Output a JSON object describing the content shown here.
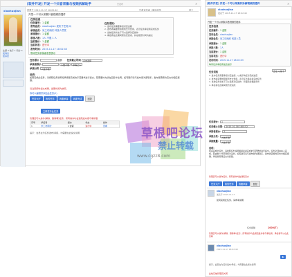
{
  "left": {
    "post_title": "[软件开发] 开发一个抖音采集与视频拆解助手",
    "post_badge": "已发布",
    "username": "xiaohuojian",
    "post_meta": "发表于 2015-11-17 18:02:40",
    "post_meta_right": "只看该作者 | 倒序浏览",
    "floor": "楼主",
    "intro": "开发一个可以采集抖音视频的插件",
    "info_header": "任务信息",
    "fields": [
      {
        "k": "任务编号",
        "v": "1 金额"
      },
      {
        "k": "发布会员",
        "v": "xiaohuojian 发布了任务(0)"
      },
      {
        "k": "承接会员",
        "v": "米工坊雨欣 科技人员发"
      },
      {
        "k": "承接报价",
        "v": "1 金额"
      },
      {
        "k": "承接人数",
        "v": "1人 不限 1 人"
      },
      {
        "k": "当前报价",
        "v": "1 金额"
      },
      {
        "k": "当前状态",
        "v": "进行中"
      },
      {
        "k": "发布时间",
        "v": "2015-11-17 18:02:40"
      }
    ],
    "status_line": "等待任务承接者发表提示",
    "task_notes_title": "任务须知：",
    "task_notes": [
      "1. 发布任务需要承担对应金额",
      "2. 发布者需要按照规则支付费用，表示任务承接者完成任务",
      "3. 当前任务状态下可以选择对应操作",
      "4. 承接者在此期间按约定完成，并在规定时间内提交"
    ],
    "bid_label": "任务报价",
    "bid_unit": "金额",
    "deadline_label": "任务截止时间",
    "deadline_value": "点击选择",
    "handle_label": "承接者报价",
    "handle_sel_1": "人数不限",
    "handle_sel_2": "中等之人",
    "category_label": "承接分类",
    "category_sel": "人数不限",
    "desc_label": "说明：",
    "desc": "如需完成此任务，请按照任务说明和承接者完成的示范要求进行提交，若需要补充请在回复中注明。如有疑问请与发布者沟通联系，发布者需按约定支付相应报酬。",
    "desc_highlight": "请注意按时提交成果，逾期将视为放弃。",
    "edit_label": "你可以编辑并添加此任务(0)",
    "action_buttons": [
      "任务大厅",
      "我的任务",
      "我要承接",
      "我要完成",
      "回复"
    ],
    "publish_button": "立即发布此任务",
    "warn_text": "管理员可以操作(解除、删除等)任务，所有操作均会通知发布者与承接者",
    "table_headers": [
      "序号",
      "承接者",
      "报价",
      "状态",
      "操作"
    ],
    "table_row": [
      "1",
      "米工坊雨欣",
      "1 金额",
      "进行中",
      "查看"
    ],
    "footer_note": "提示：会员在为任务发布/承接，均需要在此提交说明",
    "sidebar_profile_lines": [
      "主题 0  帖子 1  积分 3",
      "发消息",
      "加好友"
    ]
  },
  "right": {
    "post_title": "[软件开发] 开发一个可以采集并拆解视频的插件",
    "username": "xiaohuojian",
    "post_meta": "发表于 2015-11-17 18:02:40",
    "intro": "开发一个可以采集抖音视频的插件",
    "info_header": "任务信息",
    "fields": [
      {
        "k": "任务编号",
        "v": "1 金额"
      },
      {
        "k": "发布会员",
        "v": "xiaohuojian"
      },
      {
        "k": "承接会员",
        "v": "米工坊雨欣 科技人员"
      },
      {
        "k": "承接报价",
        "v": "1 金额"
      },
      {
        "k": "承接人数",
        "v": "1人"
      },
      {
        "k": "当前报价",
        "v": "1 金额"
      },
      {
        "k": "当前状态",
        "v": "进行中"
      },
      {
        "k": "发布时间",
        "v": "2015-11-17 18:02:03"
      }
    ],
    "status_line": "等待任务承接者发表提示",
    "notes_title": "任务须知",
    "notes_sel": "正在 以前十",
    "notes": [
      "1. 发布任务需要承担对应金额，以免影响任务完成进度",
      "2. 发布者需要按照规则支付费用，表示任务承接者完成任务",
      "3. 当前任务状态下可以选择对应操作，管理员将根据条件",
      "4. 承接者在此期间按约定完成"
    ],
    "form": [
      {
        "k": "任务报价：",
        "v": "1"
      },
      {
        "k": "任务截止日期：",
        "v": "2015-01-18 180152"
      },
      {
        "k": "承接者报价：",
        "v": "1"
      },
      {
        "k": "承接分类：",
        "v": "人数不限"
      },
      {
        "k": "承接数量：",
        "v": "人数不限"
      }
    ],
    "desc_label": "说明：",
    "desc": "如需完成此任务，请按照任务说明和承接者完成的示范要求进行提交。任务必须由本人完成，若由他人代劳则视为违约。如有疑问请与发布者沟通联系，发布者需按约定支付相应报酬，承接者需保证交付质量。",
    "highlight": "管理员可以操作任务，所有操作均会通知双方",
    "buttons": [
      "任务大厅",
      "我的任务",
      "我要承接",
      "回复"
    ],
    "reply_user": "xiaohuojian",
    "reply_time": "发表于 2015-11-17",
    "reply_text": "如何完成此任务，请参考说明",
    "reward_label": "任务报酬",
    "reward_value": "1000(T)",
    "warn_text": "管理员可以操作(解除、删除等)任务，所有操作均会通知发布者与承接者，承接者可以在此查看",
    "bottom_user": "xiaohuojian",
    "bottom_time": "2015-11-17 18:02:40",
    "footer_note": "提示：会员在为任务发布/承接，均需要在此提交说明",
    "footer_red": "此帖已被管理员关闭"
  },
  "watermark": {
    "line1": "草根吧论坛",
    "line2": "禁止转载",
    "line3": "www.cgzz8.com"
  },
  "colors": {
    "accent": "#2a6ad8",
    "red": "#d23131",
    "green": "#2f8f2f",
    "header_bg": "#f2f2f2"
  }
}
